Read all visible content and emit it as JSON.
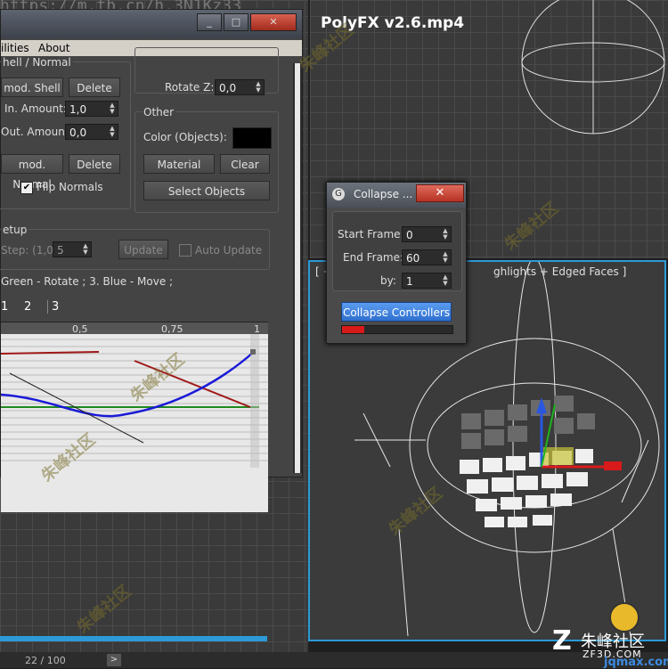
{
  "video_title": "PolyFX v2.6.mp4",
  "url_watermark": "https://m.tb.cn/h.3N1Kz33",
  "menu": [
    "ilities",
    "About"
  ],
  "panel": {
    "section_top": "hell / Normal",
    "shell_modifier_button": "mod. Shell",
    "delete_shell_button": "Delete",
    "in_amount_label": "In. Amount:",
    "in_amount_value": "1,0",
    "out_amount_label": "Out. Amount:",
    "out_amount_value": "0,0",
    "normal_modifier_button": "mod. Normal",
    "delete_normal_button": "Delete",
    "flip_normals_label": "Flip Normals",
    "rotate_z_label": "Rotate Z:",
    "rotate_z_value": "0,0",
    "other_group_label": "Other",
    "color_label": "Color (Objects):",
    "material_button": "Material",
    "clear_button": "Clear",
    "select_objects_button": "Select Objects",
    "setup_label": "etup",
    "step_label": "Step: (1,0/",
    "step_value": "5",
    "update_button": "Update",
    "auto_update_label": "Auto Update",
    "legend_text": "Green - Rotate ; 3. Blue - Move ;",
    "tabs": [
      "1",
      "2",
      "3"
    ],
    "ruler_ticks": [
      "0,5",
      "0,75",
      "1"
    ]
  },
  "dialog": {
    "title": "Collapse ...",
    "start_frame_label": "Start Frame:",
    "start_frame_value": "0",
    "end_frame_label": "End Frame:",
    "end_frame_value": "60",
    "by_label": "by:",
    "by_value": "1",
    "collapse_button": "Collapse Controllers",
    "progress": 0.2
  },
  "viewport_label": "ghlights + Edged Faces ]",
  "viewport_prefix": "[ +",
  "timeline_text": "22 / 100",
  "timeline_progress": 0.22,
  "brand": {
    "name": "朱峰社区",
    "domain": "ZF3D.COM",
    "site": "jqmax.com"
  },
  "watermark_glyph": "朱峰社区",
  "colors": {
    "accent": "#3c7fd8",
    "red": "#d81a1a",
    "viewport_border": "#2b9ad6"
  }
}
